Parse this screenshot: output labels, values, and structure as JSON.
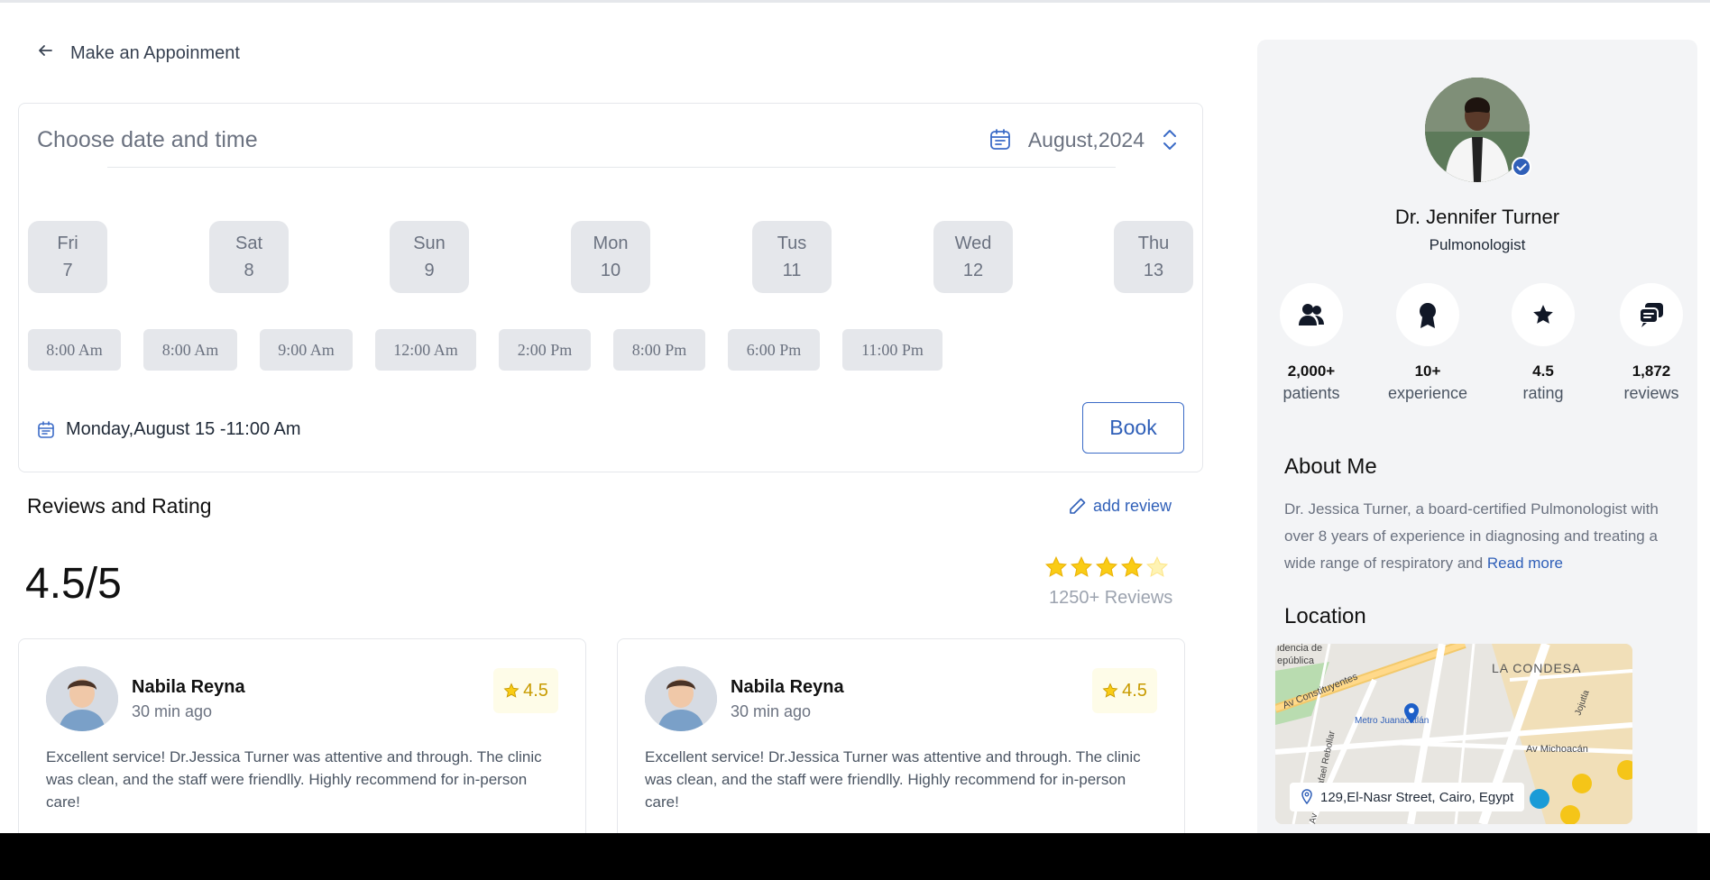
{
  "header": {
    "back_label": "Make an Appoinment"
  },
  "booking": {
    "title": "Choose date and time",
    "month": "August,2024",
    "days": [
      {
        "weekday": "Fri",
        "date": "7"
      },
      {
        "weekday": "Sat",
        "date": "8"
      },
      {
        "weekday": "Sun",
        "date": "9"
      },
      {
        "weekday": "Mon",
        "date": "10"
      },
      {
        "weekday": "Tus",
        "date": "11"
      },
      {
        "weekday": "Wed",
        "date": "12"
      },
      {
        "weekday": "Thu",
        "date": "13"
      }
    ],
    "slots": [
      "8:00 Am",
      "8:00 Am",
      "9:00 Am",
      "12:00 Am",
      "2:00 Pm",
      "8:00 Pm",
      "6:00 Pm",
      "11:00 Pm"
    ],
    "selected": "Monday,August 15 -11:00 Am",
    "book_label": "Book"
  },
  "reviews": {
    "title": "Reviews and Rating",
    "add_label": "add review",
    "overall": "4.5/5",
    "count_label": "1250+ Reviews",
    "stars_filled": 4,
    "stars_total": 5,
    "items": [
      {
        "name": "Nabila Reyna",
        "time": "30 min ago",
        "rating": "4.5",
        "text": "Excellent service! Dr.Jessica Turner was attentive and through. The clinic was clean, and the staff were friendlly. Highly recommend for in-person care!"
      },
      {
        "name": "Nabila Reyna",
        "time": "30 min ago",
        "rating": "4.5",
        "text": "Excellent service! Dr.Jessica Turner was attentive and through. The clinic was clean, and the staff were friendlly. Highly recommend for in-person care!"
      }
    ]
  },
  "doctor": {
    "name": "Dr. Jennifer Turner",
    "specialty": "Pulmonologist",
    "stats": [
      {
        "value": "2,000+",
        "label": "patients",
        "icon": "patients-icon"
      },
      {
        "value": "10+",
        "label": "experience",
        "icon": "award-icon"
      },
      {
        "value": "4.5",
        "label": "rating",
        "icon": "star-icon"
      },
      {
        "value": "1,872",
        "label": "reviews",
        "icon": "chat-icon"
      }
    ],
    "about_title": "About Me",
    "about_text": "Dr. Jessica Turner, a board-certified Pulmonologist with over 8 years of experience in diagnosing and treating a wide range of respiratory and ",
    "read_more": "Read more",
    "location_title": "Location",
    "address": "129,El-Nasr Street, Cairo, Egypt",
    "map_labels": {
      "residencia": "idencia de",
      "republica": "epública",
      "constituyentes": "Av Constituyentes",
      "rebollar": "Av Gral Rafael Rebollar",
      "condesa": "LA CONDESA",
      "michoacan": "Av Michoacán",
      "metro": "Metro Juanacatlán",
      "jojutla": "Jojutla"
    }
  },
  "colors": {
    "accent": "#2f5fb8",
    "star": "#facc15",
    "chip": "#e5e7eb",
    "panel": "#f3f4f6"
  }
}
